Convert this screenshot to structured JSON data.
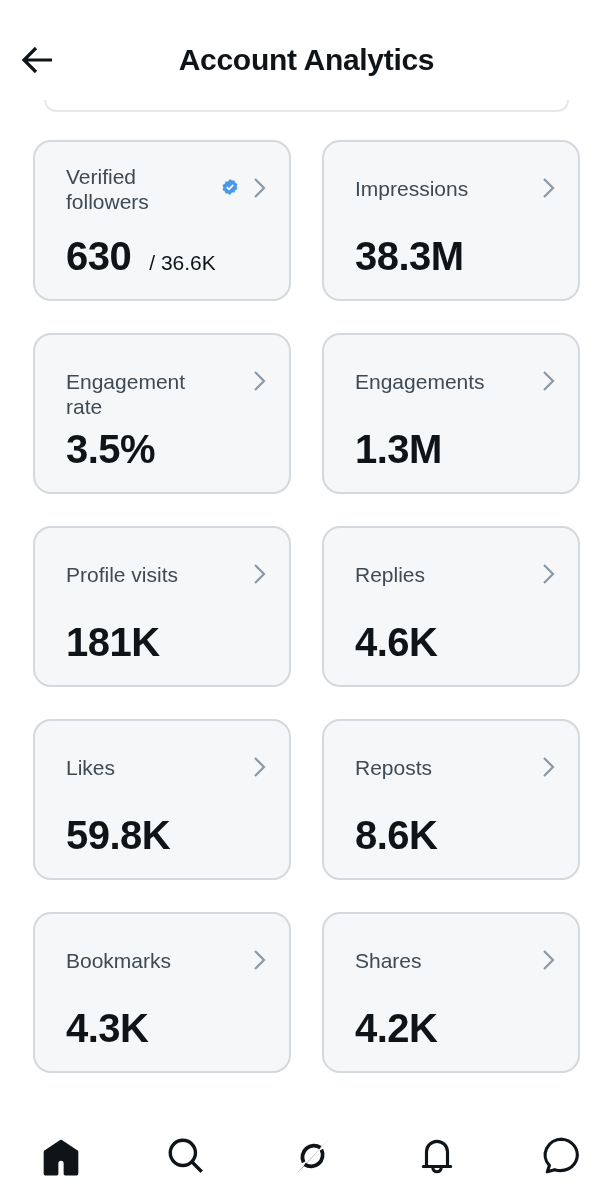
{
  "header": {
    "title": "Account Analytics"
  },
  "metrics": [
    {
      "label": "Verified followers",
      "value": "630",
      "total": "/ 36.6K",
      "verified": true
    },
    {
      "label": "Impressions",
      "value": "38.3M"
    },
    {
      "label": "Engagement rate",
      "value": "3.5%"
    },
    {
      "label": "Engagements",
      "value": "1.3M"
    },
    {
      "label": "Profile visits",
      "value": "181K"
    },
    {
      "label": "Replies",
      "value": "4.6K"
    },
    {
      "label": "Likes",
      "value": "59.8K"
    },
    {
      "label": "Reposts",
      "value": "8.6K"
    },
    {
      "label": "Bookmarks",
      "value": "4.3K"
    },
    {
      "label": "Shares",
      "value": "4.2K"
    }
  ],
  "nav": [
    {
      "kind": "home",
      "selected": true
    },
    {
      "kind": "search",
      "selected": false
    },
    {
      "kind": "grok",
      "selected": false
    },
    {
      "kind": "bell",
      "selected": false
    },
    {
      "kind": "chat",
      "selected": false
    }
  ]
}
